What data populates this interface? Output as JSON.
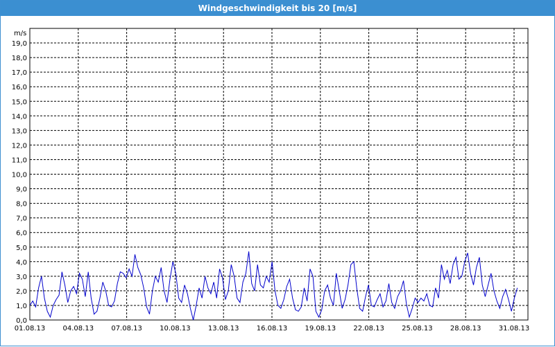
{
  "window": {
    "title": "Windgeschwindigkeit bis 20 [m/s]"
  },
  "colors": {
    "titlebar": "#3b8fd1",
    "series": "#0000cc",
    "grid": "#000000"
  },
  "chart_data": {
    "type": "line",
    "title": "Windgeschwindigkeit bis 20 [m/s]",
    "ylabel": "m/s",
    "xlabel": "",
    "ylim": [
      0,
      20
    ],
    "y_ticks": [
      "0,0",
      "1,0",
      "2,0",
      "3,0",
      "4,0",
      "5,0",
      "6,0",
      "7,0",
      "8,0",
      "9,0",
      "10,0",
      "11,0",
      "12,0",
      "13,0",
      "14,0",
      "15,0",
      "16,0",
      "17,0",
      "18,0",
      "19,0"
    ],
    "x_range_days": [
      "01.08.13",
      "31.08.13"
    ],
    "x_ticks": [
      "01.08.13",
      "04.08.13",
      "07.08.13",
      "10.08.13",
      "13.08.13",
      "16.08.13",
      "19.08.13",
      "22.08.13",
      "25.08.13",
      "28.08.13",
      "31.08.13"
    ],
    "grid": true,
    "series": [
      {
        "values": [
          [
            0.0,
            1.0
          ],
          [
            0.2,
            1.3
          ],
          [
            0.4,
            0.9
          ],
          [
            0.6,
            2.2
          ],
          [
            0.8,
            3.0
          ],
          [
            1.0,
            1.5
          ],
          [
            1.2,
            0.6
          ],
          [
            1.4,
            0.2
          ],
          [
            1.6,
            1.0
          ],
          [
            1.8,
            1.4
          ],
          [
            2.0,
            1.7
          ],
          [
            2.2,
            3.3
          ],
          [
            2.4,
            2.4
          ],
          [
            2.6,
            1.2
          ],
          [
            2.8,
            2.0
          ],
          [
            3.0,
            2.3
          ],
          [
            3.2,
            1.8
          ],
          [
            3.4,
            3.2
          ],
          [
            3.6,
            2.8
          ],
          [
            3.8,
            1.6
          ],
          [
            4.0,
            3.3
          ],
          [
            4.2,
            1.5
          ],
          [
            4.4,
            0.4
          ],
          [
            4.6,
            0.6
          ],
          [
            4.8,
            1.5
          ],
          [
            5.0,
            2.6
          ],
          [
            5.2,
            2.0
          ],
          [
            5.4,
            1.0
          ],
          [
            5.6,
            0.9
          ],
          [
            5.8,
            1.3
          ],
          [
            6.0,
            2.5
          ],
          [
            6.2,
            3.3
          ],
          [
            6.4,
            3.2
          ],
          [
            6.6,
            2.9
          ],
          [
            6.8,
            3.5
          ],
          [
            7.0,
            3.0
          ],
          [
            7.2,
            4.5
          ],
          [
            7.4,
            3.6
          ],
          [
            7.6,
            3.1
          ],
          [
            7.8,
            2.2
          ],
          [
            8.0,
            0.9
          ],
          [
            8.2,
            0.4
          ],
          [
            8.4,
            2.0
          ],
          [
            8.6,
            3.0
          ],
          [
            8.8,
            2.6
          ],
          [
            9.0,
            3.6
          ],
          [
            9.2,
            2.0
          ],
          [
            9.4,
            1.2
          ],
          [
            9.6,
            2.8
          ],
          [
            9.8,
            4.0
          ],
          [
            10.0,
            3.2
          ],
          [
            10.2,
            1.5
          ],
          [
            10.4,
            1.2
          ],
          [
            10.6,
            2.4
          ],
          [
            10.8,
            1.8
          ],
          [
            11.0,
            0.8
          ],
          [
            11.2,
            0.0
          ],
          [
            11.4,
            1.0
          ],
          [
            11.6,
            2.2
          ],
          [
            11.8,
            1.5
          ],
          [
            12.0,
            3.0
          ],
          [
            12.2,
            2.2
          ],
          [
            12.4,
            1.8
          ],
          [
            12.6,
            2.6
          ],
          [
            12.8,
            1.5
          ],
          [
            13.0,
            3.5
          ],
          [
            13.2,
            2.9
          ],
          [
            13.4,
            1.4
          ],
          [
            13.6,
            2.0
          ],
          [
            13.8,
            3.8
          ],
          [
            14.0,
            3.0
          ],
          [
            14.2,
            1.5
          ],
          [
            14.4,
            1.2
          ],
          [
            14.6,
            2.6
          ],
          [
            14.8,
            3.2
          ],
          [
            15.0,
            4.7
          ],
          [
            15.2,
            2.5
          ],
          [
            15.4,
            2.0
          ],
          [
            15.6,
            3.8
          ],
          [
            15.8,
            2.4
          ],
          [
            16.0,
            2.2
          ],
          [
            16.2,
            3.0
          ],
          [
            16.4,
            2.6
          ],
          [
            16.6,
            4.0
          ],
          [
            16.8,
            2.0
          ],
          [
            17.0,
            1.0
          ],
          [
            17.2,
            0.8
          ],
          [
            17.4,
            1.4
          ],
          [
            17.6,
            2.3
          ],
          [
            17.8,
            2.8
          ],
          [
            18.0,
            1.5
          ],
          [
            18.2,
            0.7
          ],
          [
            18.4,
            0.6
          ],
          [
            18.6,
            0.9
          ],
          [
            18.8,
            2.2
          ],
          [
            19.0,
            1.3
          ],
          [
            19.2,
            3.5
          ],
          [
            19.4,
            3.0
          ],
          [
            19.6,
            0.6
          ],
          [
            19.8,
            0.2
          ],
          [
            20.0,
            0.7
          ],
          [
            20.2,
            2.0
          ],
          [
            20.4,
            2.4
          ],
          [
            20.6,
            1.5
          ],
          [
            20.8,
            1.0
          ],
          [
            21.0,
            3.2
          ],
          [
            21.2,
            2.0
          ],
          [
            21.4,
            0.8
          ],
          [
            21.6,
            1.4
          ],
          [
            21.8,
            2.4
          ],
          [
            22.0,
            3.8
          ],
          [
            22.2,
            4.0
          ],
          [
            22.4,
            2.2
          ],
          [
            22.6,
            0.8
          ],
          [
            22.8,
            0.6
          ],
          [
            23.0,
            1.6
          ],
          [
            23.2,
            2.4
          ],
          [
            23.4,
            1.0
          ],
          [
            23.6,
            0.9
          ],
          [
            23.8,
            1.4
          ],
          [
            24.0,
            1.8
          ],
          [
            24.2,
            0.9
          ],
          [
            24.4,
            1.3
          ],
          [
            24.6,
            2.5
          ],
          [
            24.8,
            1.2
          ],
          [
            25.0,
            0.8
          ],
          [
            25.2,
            1.6
          ],
          [
            25.4,
            2.0
          ],
          [
            25.6,
            2.7
          ],
          [
            25.8,
            1.1
          ],
          [
            26.0,
            0.2
          ],
          [
            26.2,
            0.8
          ],
          [
            26.4,
            1.5
          ],
          [
            26.6,
            1.2
          ],
          [
            26.8,
            1.5
          ],
          [
            27.0,
            1.3
          ],
          [
            27.2,
            1.8
          ],
          [
            27.4,
            1.0
          ],
          [
            27.6,
            0.9
          ],
          [
            27.8,
            2.2
          ],
          [
            28.0,
            1.5
          ],
          [
            28.2,
            3.8
          ],
          [
            28.4,
            2.8
          ],
          [
            28.6,
            3.4
          ],
          [
            28.8,
            2.5
          ],
          [
            29.0,
            3.8
          ],
          [
            29.2,
            4.3
          ],
          [
            29.4,
            2.8
          ],
          [
            29.6,
            3.0
          ],
          [
            29.8,
            4.0
          ],
          [
            30.0,
            4.6
          ],
          [
            30.2,
            3.2
          ],
          [
            30.4,
            2.4
          ],
          [
            30.6,
            3.6
          ],
          [
            30.8,
            4.3
          ],
          [
            31.0,
            2.4
          ],
          [
            31.2,
            1.6
          ],
          [
            31.4,
            2.4
          ],
          [
            31.6,
            3.2
          ],
          [
            31.8,
            2.0
          ],
          [
            32.0,
            1.3
          ],
          [
            32.2,
            0.8
          ],
          [
            32.4,
            1.6
          ],
          [
            32.6,
            2.1
          ],
          [
            32.8,
            1.4
          ],
          [
            33.0,
            0.6
          ],
          [
            33.2,
            1.5
          ],
          [
            33.4,
            2.2
          ]
        ]
      }
    ],
    "plot_area": null
  }
}
